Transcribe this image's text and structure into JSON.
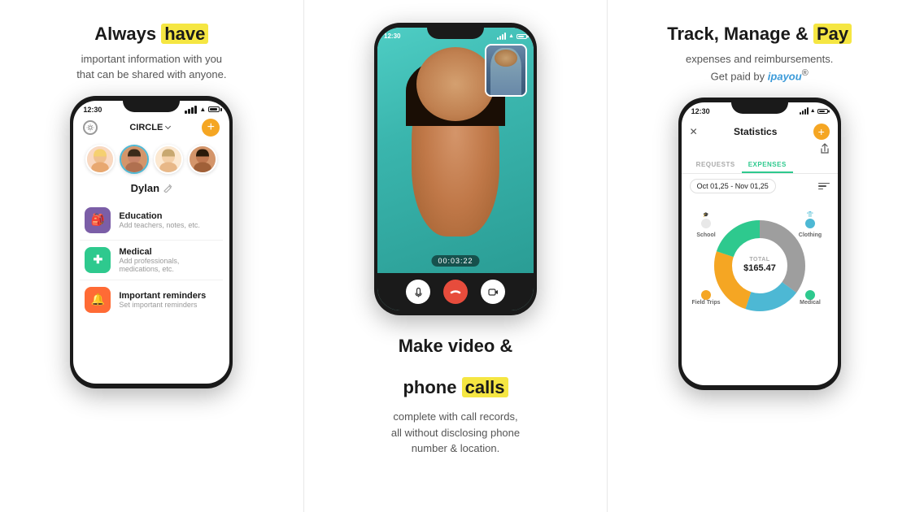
{
  "panels": {
    "left": {
      "heading_plain": "Always ",
      "heading_highlight": "have",
      "sub1": "important information with you",
      "sub2": "that can be shared with anyone.",
      "phone": {
        "status_time": "12:30",
        "circle_label": "CIRCLE",
        "user_name": "Dylan",
        "menu_items": [
          {
            "icon": "🎒",
            "icon_class": "icon-edu",
            "title": "Education",
            "sub": "Add teachers, notes, etc."
          },
          {
            "icon": "✚",
            "icon_class": "icon-med",
            "title": "Medical",
            "sub": "Add professionals, medications, etc."
          },
          {
            "icon": "🔔",
            "icon_class": "icon-rem",
            "title": "Important reminders",
            "sub": "Set important reminders"
          }
        ]
      }
    },
    "center": {
      "heading_plain": "Make video &",
      "heading_highlight_pre": "phone ",
      "heading_highlight": "calls",
      "sub1": "complete with call records,",
      "sub2": "all without disclosing phone",
      "sub3": "number & location.",
      "phone": {
        "status_time": "12:30",
        "call_timer": "00:03:22"
      }
    },
    "right": {
      "heading_plain": "Track, Manage & ",
      "heading_highlight": "Pay",
      "sub1": "expenses and reimbursements.",
      "sub2_plain": "Get paid by ",
      "sub2_brand": "ipayou",
      "sub2_sup": "®",
      "phone": {
        "status_time": "12:30",
        "stat_title": "Statistics",
        "tab_requests": "REQUESTS",
        "tab_expenses": "EXPENSES",
        "date_range": "Oct 01,25 - Nov 01,25",
        "chart": {
          "total_label": "TOTAL",
          "total_amount": "$165.47",
          "segments": [
            {
              "label": "School",
              "color": "#9e9e9e",
              "percent": 35
            },
            {
              "label": "Clothing",
              "color": "#4db8d4",
              "percent": 20
            },
            {
              "label": "Medical",
              "color": "#2ec98e",
              "percent": 20
            },
            {
              "label": "Field Trips",
              "color": "#f5a623",
              "percent": 25
            }
          ]
        }
      }
    }
  },
  "colors": {
    "highlight_yellow": "#f5e642",
    "green_accent": "#2ec98e",
    "orange_accent": "#f5a623",
    "brand_blue": "#3a9ad9"
  }
}
